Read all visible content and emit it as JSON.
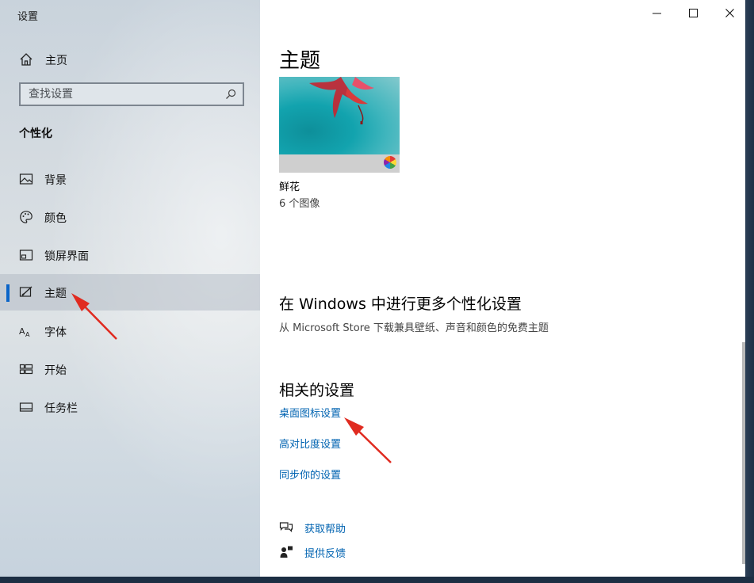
{
  "window": {
    "title": "设置"
  },
  "sidebar": {
    "home_label": "主页",
    "search_placeholder": "查找设置",
    "section_title": "个性化",
    "items": [
      {
        "label": "背景",
        "icon": "picture-icon"
      },
      {
        "label": "颜色",
        "icon": "palette-icon"
      },
      {
        "label": "锁屏界面",
        "icon": "lockscreen-icon"
      },
      {
        "label": "主题",
        "icon": "theme-icon",
        "active": true
      },
      {
        "label": "字体",
        "icon": "font-icon"
      },
      {
        "label": "开始",
        "icon": "start-icon"
      },
      {
        "label": "任务栏",
        "icon": "taskbar-icon"
      }
    ]
  },
  "main": {
    "title": "主题",
    "theme": {
      "name": "鲜花",
      "count": "6 个图像"
    },
    "store": {
      "heading": "在 Windows 中进行更多个性化设置",
      "desc": "从 Microsoft Store 下载兼具壁纸、声音和颜色的免费主题"
    },
    "related": {
      "heading": "相关的设置",
      "links": [
        "桌面图标设置",
        "高对比度设置",
        "同步你的设置"
      ]
    },
    "help": {
      "get_help": "获取帮助",
      "feedback": "提供反馈"
    }
  },
  "colors": {
    "accent": "#0a64c8",
    "link": "#0063b1",
    "annotation_arrow": "#e02b20"
  }
}
